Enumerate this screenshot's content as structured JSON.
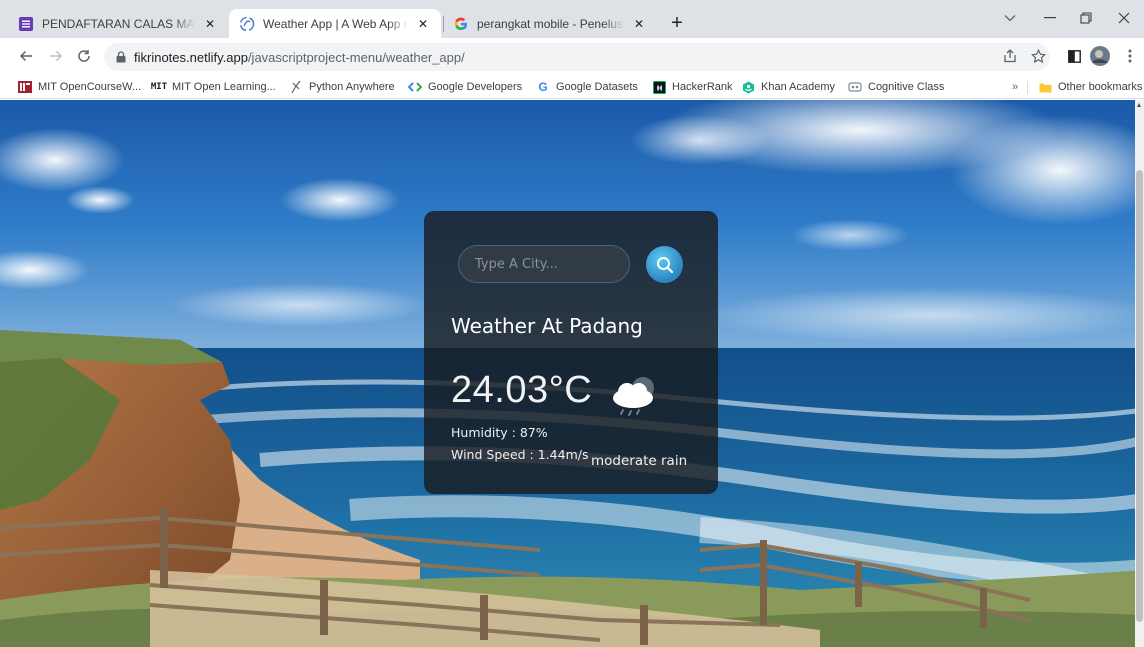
{
  "browser": {
    "tabs": [
      {
        "title": "PENDAFTARAN CALAS MATHDAS",
        "favicon": "forms-list-icon",
        "color": "#673ab7",
        "active": false
      },
      {
        "title": "Weather App | A Web App made with",
        "favicon": "netlify-spinner-icon",
        "color": "#4a7ecb",
        "active": true
      },
      {
        "title": "perangkat mobile - Penelusuran Google",
        "favicon": "google-g-icon",
        "color": "#4285f4",
        "active": false
      }
    ],
    "new_tab_label": "+",
    "address": {
      "host": "fikrinotes.netlify.app",
      "path": "/javascriptproject-menu/weather_app/"
    },
    "bookmarks": [
      {
        "label": "MIT OpenCourseW...",
        "icon": "mit-ocw-icon"
      },
      {
        "label": "MIT Open Learning...",
        "icon": "mit-logo-icon"
      },
      {
        "label": "Python Anywhere",
        "icon": "python-anywhere-icon"
      },
      {
        "label": "Google Developers",
        "icon": "google-developers-icon"
      },
      {
        "label": "Google Datasets",
        "icon": "google-g-icon"
      },
      {
        "label": "HackerRank",
        "icon": "hackerrank-icon"
      },
      {
        "label": "Khan Academy",
        "icon": "khan-academy-icon"
      },
      {
        "label": "Cognitive Class",
        "icon": "cognitive-class-icon"
      }
    ],
    "bookmarks_overflow": "»",
    "other_bookmarks": "Other bookmarks"
  },
  "weather": {
    "search_placeholder": "Type A City...",
    "search_value": "",
    "city_title": "Weather At Padang",
    "temperature": "24.03°C",
    "humidity": "Humidity : 87%",
    "wind": "Wind Speed : 1.44m/s",
    "description": "moderate rain",
    "condition_icon": "rain-cloud-icon"
  },
  "colors": {
    "accent": "#2f95d6",
    "card_bg": "#1b1d22",
    "sky": "#2a6fc0",
    "ocean": "#1a5f9a"
  }
}
